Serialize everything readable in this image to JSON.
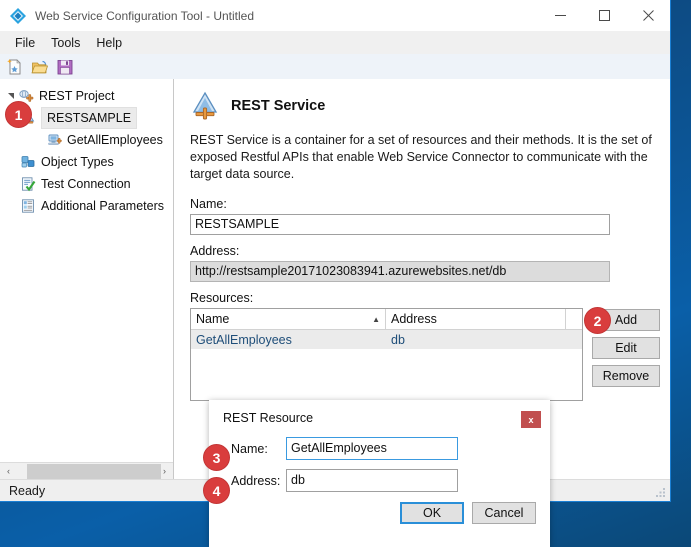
{
  "window": {
    "title": "Web Service Configuration Tool - Untitled",
    "icon": "app-diamond-icon",
    "minimize_label": "—",
    "maximize_label": "□",
    "close_label": "✕"
  },
  "menubar": {
    "items": [
      {
        "label": "File"
      },
      {
        "label": "Tools"
      },
      {
        "label": "Help"
      }
    ]
  },
  "toolbar": {
    "buttons": [
      {
        "name": "new-project-icon",
        "tooltip": "New"
      },
      {
        "name": "open-project-icon",
        "tooltip": "Open"
      },
      {
        "name": "save-project-icon",
        "tooltip": "Save"
      }
    ]
  },
  "sidebar": {
    "tree": [
      {
        "label": "REST Project",
        "icon": "rest-project-icon",
        "level": 0,
        "expanded": true,
        "selected": false
      },
      {
        "label": "RESTSAMPLE",
        "icon": "rest-service-icon",
        "level": 1,
        "expanded": false,
        "selected": true
      },
      {
        "label": "GetAllEmployees",
        "icon": "rest-resource-icon",
        "level": 2,
        "expanded": false,
        "selected": false
      },
      {
        "label": "Object Types",
        "icon": "object-types-icon",
        "level": 1,
        "expanded": false,
        "selected": false
      },
      {
        "label": "Test Connection",
        "icon": "test-connection-icon",
        "level": 1,
        "expanded": false,
        "selected": false
      },
      {
        "label": "Additional Parameters",
        "icon": "additional-parameters-icon",
        "level": 1,
        "expanded": false,
        "selected": false
      }
    ],
    "scrollbar": {
      "left_arrow": "‹",
      "right_arrow": "›"
    }
  },
  "main": {
    "page_title": "REST Service",
    "page_icon": "rest-service-large-icon",
    "description": "REST Service is a container for a set of resources and their methods. It is the set of exposed Restful APIs that enable Web Service Connector to communicate with the target data source.",
    "name_label": "Name:",
    "name_value": "RESTSAMPLE",
    "address_label": "Address:",
    "address_value": "http://restsample20171023083941.azurewebsites.net/db",
    "resources_label": "Resources:",
    "grid": {
      "columns": [
        "Name",
        "Address"
      ],
      "sort_column": "Name",
      "sort_caret": "▲",
      "rows": [
        {
          "name": "GetAllEmployees",
          "address": "db"
        }
      ]
    },
    "buttons": [
      {
        "label": "Add"
      },
      {
        "label": "Edit"
      },
      {
        "label": "Remove"
      }
    ]
  },
  "statusbar": {
    "text": "Ready"
  },
  "dialog": {
    "title": "REST Resource",
    "close_label": "x",
    "name_label": "Name:",
    "name_value": "GetAllEmployees",
    "address_label": "Address:",
    "address_value": "db",
    "ok_label": "OK",
    "cancel_label": "Cancel"
  },
  "callouts": [
    {
      "id": 1,
      "label": "1"
    },
    {
      "id": 2,
      "label": "2"
    },
    {
      "id": 3,
      "label": "3"
    },
    {
      "id": 4,
      "label": "4"
    }
  ],
  "colors": {
    "accent": "#1a7fd4",
    "badge": "#d93d3d",
    "selection": "#ebebeb",
    "grid_text": "#1f4e79",
    "desktop": "#0d4d87"
  }
}
